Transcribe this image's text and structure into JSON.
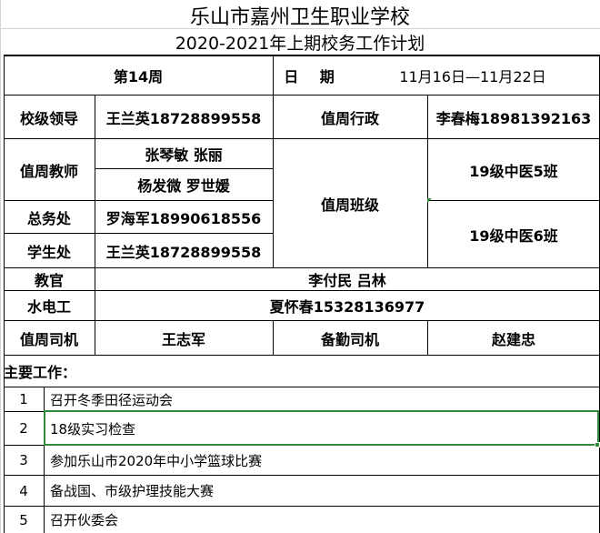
{
  "title": "乐山市嘉州卫生职业学校",
  "subtitle": "2020-2021年上期校务工作计划",
  "week": {
    "label": "第14周",
    "date_label": "日 期",
    "date_value": "11月16日—11月22日"
  },
  "leaders": {
    "label": "校级领导",
    "value": "王兰英18728899558",
    "admin_label": "值周行政",
    "admin_value": "李春梅18981392163"
  },
  "teachers": {
    "label": "值周教师",
    "row1": "张琴敏 张丽",
    "row2": "杨发微 罗世媛"
  },
  "duty_class": {
    "label": "值周班级",
    "class1": "19级中医5班",
    "class2": "19级中医6班"
  },
  "general_affairs": {
    "label": "总务处",
    "value": "罗海军18990618556"
  },
  "student_office": {
    "label": "学生处",
    "value": "王兰英18728899558"
  },
  "instructor": {
    "label": "教官",
    "value": "李付民 吕林"
  },
  "utilities": {
    "label": "水电工",
    "value": "夏怀春15328136977"
  },
  "drivers": {
    "label": "值周司机",
    "value": "王志军",
    "backup_label": "备勤司机",
    "backup_value": "赵建忠"
  },
  "tasks_label": "主要工作：",
  "tasks": [
    {
      "num": "1",
      "text": "召开冬季田径运动会"
    },
    {
      "num": "2",
      "text": "18级实习检查"
    },
    {
      "num": "3",
      "text": "参加乐山市2020年中小学篮球比赛"
    },
    {
      "num": "4",
      "text": "备战国、市级护理技能大赛"
    },
    {
      "num": "5",
      "text": "召开伙委会"
    }
  ],
  "colors": {
    "selection": "#2e8b3a",
    "gridline": "#d4d4d4",
    "border": "#000000"
  }
}
